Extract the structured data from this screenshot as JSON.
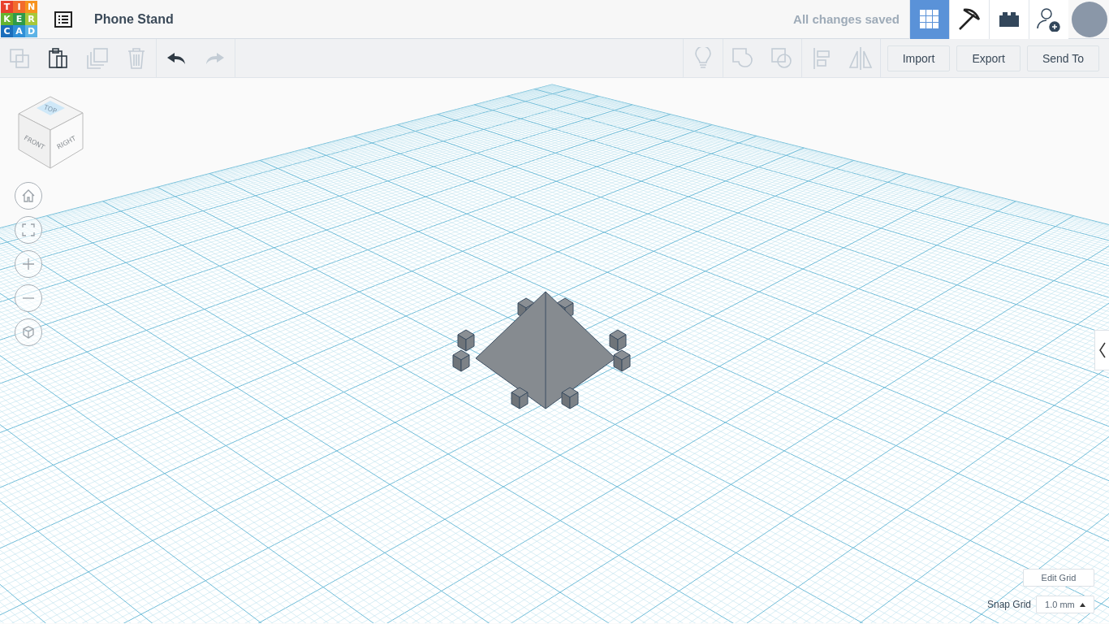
{
  "logo": {
    "letters": [
      {
        "char": "T",
        "color": "#e8412c"
      },
      {
        "char": "I",
        "color": "#f26b2c"
      },
      {
        "char": "N",
        "color": "#f7931e"
      },
      {
        "char": "K",
        "color": "#65b32e"
      },
      {
        "char": "E",
        "color": "#2f9a4a"
      },
      {
        "char": "R",
        "color": "#a7c83b"
      },
      {
        "char": "C",
        "color": "#1a6dbb"
      },
      {
        "char": "A",
        "color": "#2f8fd7"
      },
      {
        "char": "D",
        "color": "#5db3e6"
      }
    ]
  },
  "title": "Phone Stand",
  "save_status": "All changes saved",
  "view_modes": [
    {
      "kind": "grid",
      "selected": true
    },
    {
      "kind": "pickaxe",
      "selected": false
    },
    {
      "kind": "brick",
      "selected": false
    }
  ],
  "toolbar": {
    "edit_tools": [
      {
        "kind": "copy",
        "disabled": true
      },
      {
        "kind": "paste",
        "disabled": false
      },
      {
        "kind": "duplicate",
        "disabled": true
      },
      {
        "kind": "delete",
        "disabled": true
      }
    ],
    "history": [
      {
        "kind": "undo",
        "disabled": false
      },
      {
        "kind": "redo",
        "disabled": true
      }
    ],
    "shape_tools": [
      {
        "kind": "bulb",
        "disabled": true
      },
      {
        "kind": "group",
        "disabled": true
      },
      {
        "kind": "ungroup",
        "disabled": true
      },
      {
        "kind": "align",
        "disabled": true
      },
      {
        "kind": "mirror",
        "disabled": true
      }
    ],
    "buttons": [
      "Import",
      "Export",
      "Send To"
    ]
  },
  "view_cube": {
    "top": "TOP",
    "front": "FRONT",
    "right": "RIGHT"
  },
  "nav_controls": [
    {
      "kind": "home"
    },
    {
      "kind": "fit"
    },
    {
      "kind": "zoom-in"
    },
    {
      "kind": "zoom-out"
    },
    {
      "kind": "perspective"
    }
  ],
  "edit_grid": "Edit Grid",
  "snap_grid": {
    "label": "Snap Grid",
    "value": "1.0 mm"
  }
}
